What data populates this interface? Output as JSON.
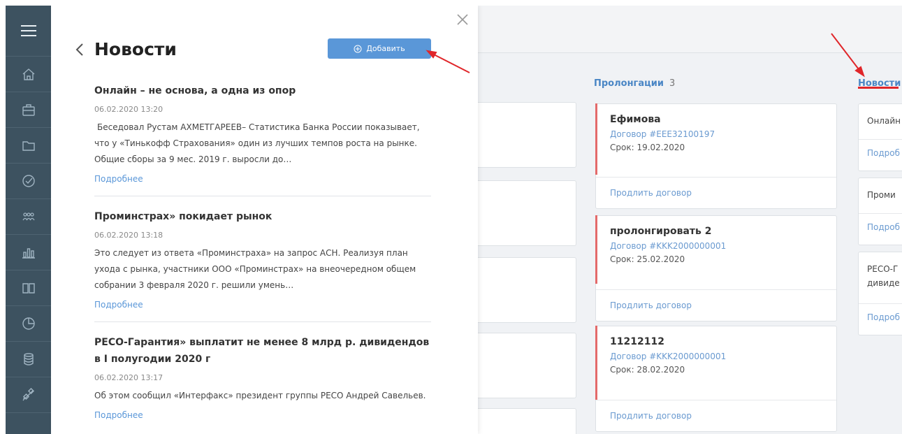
{
  "panel": {
    "title": "Новости",
    "add_label": "Добавить",
    "news": [
      {
        "title": "Онлайн – не основа, а одна из опор",
        "date": "06.02.2020 13:20",
        "text": "Беседовал Рустам АХМЕТГАРЕЕВ– Статистика Банка России показывает, что у «Тинькофф Страхования» один из лучших темпов роста на рынке. Общие сборы за 9 мес. 2019 г. выросли до…",
        "more": "Подробнее"
      },
      {
        "title": "Проминстрах» покидает рынок",
        "date": "06.02.2020 13:18",
        "text": "Это следует из ответа «Проминстраха» на запрос АСН. Реализуя план ухода с рынка, участники ООО «Проминстрах» на внеочередном общем собрании 3 февраля 2020 г. решили умень…",
        "more": "Подробнее"
      },
      {
        "title": "РЕСО-Гарантия» выплатит не менее 8 млрд р. дивидендов в I полугодии 2020 г",
        "date": "06.02.2020 13:17",
        "text": "Об этом сообщил «Интерфакс» президент группы РЕСО Андрей Савельев.",
        "more": "Подробнее"
      }
    ]
  },
  "board": {
    "prolong": {
      "header": "Пролонгации",
      "count": "3",
      "cards": [
        {
          "name": "Ефимова",
          "contract": "Договор #EEE32100197",
          "term": "Срок: 19.02.2020",
          "action": "Продлить договор"
        },
        {
          "name": "пролонгировать 2",
          "contract": "Договор #KKK2000000001",
          "term": "Срок: 25.02.2020",
          "action": "Продлить договор"
        },
        {
          "name": "11212112",
          "contract": "Договор #KKK2000000001",
          "term": "Срок: 28.02.2020",
          "action": "Продлить договор"
        }
      ]
    },
    "news_column": {
      "header": "Новости",
      "cards": [
        {
          "text": "Онлайн",
          "more": "Подроб"
        },
        {
          "text": "Проми",
          "more": "Подроб"
        },
        {
          "text": "РЕСО-Г",
          "text2": "дивиде",
          "more": "Подроб"
        }
      ]
    }
  },
  "colors": {
    "sidebar": "#3d5260",
    "accent": "#5a97d8",
    "card_bar": "#e46a6a",
    "annotation": "#e0262a"
  },
  "icons": {
    "sidebar": [
      "menu-icon",
      "home-icon",
      "briefcase-icon",
      "folder-icon",
      "check-circle-icon",
      "users-icon",
      "bar-chart-icon",
      "book-icon",
      "pie-chart-icon",
      "database-icon",
      "satellite-icon"
    ]
  }
}
